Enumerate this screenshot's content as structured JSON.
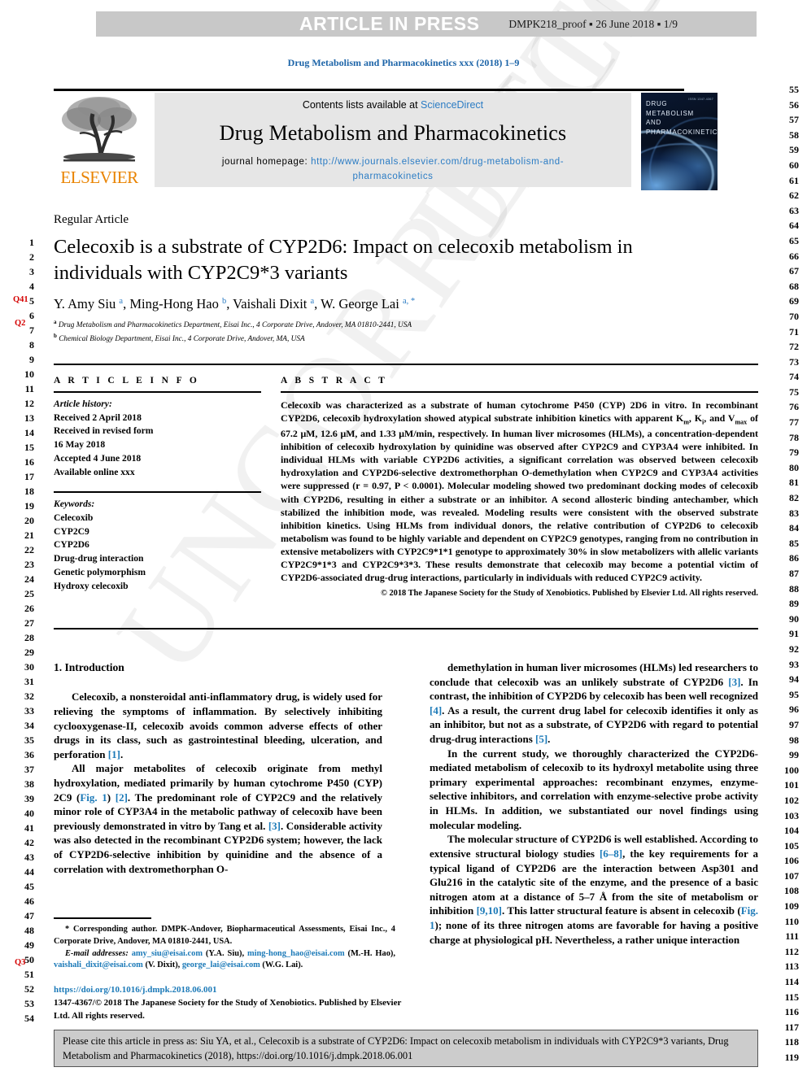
{
  "header": {
    "press_banner": "ARTICLE IN PRESS",
    "proof_meta": "DMPK218_proof ▪ 26 June 2018 ▪ 1/9",
    "running_head": "Drug Metabolism and Pharmacokinetics xxx (2018) 1–9"
  },
  "masthead": {
    "contents_prefix": "Contents lists available at ",
    "contents_link": "ScienceDirect",
    "journal_name": "Drug Metabolism and Pharmacokinetics",
    "homepage_label": "journal homepage: ",
    "homepage_url_line1": "http://www.journals.elsevier.com/drug-metabolism-and-",
    "homepage_url_line2": "pharmacokinetics",
    "publisher_logo_text": "ELSEVIER",
    "cover_title": "DRUG METABOLISM AND PHARMACOKINETICS",
    "cover_volume": "ISSN 1347-4367"
  },
  "article": {
    "type_label": "Regular Article",
    "title": "Celecoxib is a substrate of CYP2D6: Impact on celecoxib metabolism in individuals with CYP2C9*3 variants",
    "authors_plain": "Y. Amy Siu a, Ming-Hong Hao b, Vaishali Dixit a, W. George Lai a, *",
    "authors": [
      {
        "name": "Y. Amy Siu",
        "marks": "a"
      },
      {
        "name": "Ming-Hong Hao",
        "marks": "b"
      },
      {
        "name": "Vaishali Dixit",
        "marks": "a"
      },
      {
        "name": "W. George Lai",
        "marks": "a, *"
      }
    ],
    "affiliations": [
      {
        "mark": "a",
        "text": "Drug Metabolism and Pharmacokinetics Department, Eisai Inc., 4 Corporate Drive, Andover, MA 01810-2441, USA"
      },
      {
        "mark": "b",
        "text": "Chemical Biology Department, Eisai Inc., 4 Corporate Drive, Andover, MA, USA"
      }
    ]
  },
  "article_info": {
    "heading": "A R T I C L E   I N F O",
    "history_label": "Article history:",
    "history": [
      "Received 2 April 2018",
      "Received in revised form",
      "16 May 2018",
      "Accepted 4 June 2018",
      "Available online xxx"
    ],
    "keywords_label": "Keywords:",
    "keywords": [
      "Celecoxib",
      "CYP2C9",
      "CYP2D6",
      "Drug-drug interaction",
      "Genetic polymorphism",
      "Hydroxy celecoxib"
    ]
  },
  "abstract": {
    "heading": "A B S T R A C T",
    "text": "Celecoxib was characterized as a substrate of human cytochrome P450 (CYP) 2D6 in vitro. In recombinant CYP2D6, celecoxib hydroxylation showed atypical substrate inhibition kinetics with apparent Km, Ki, and Vmax of 67.2 μM, 12.6 μM, and 1.33 μM/min, respectively. In human liver microsomes (HLMs), a concentration-dependent inhibition of celecoxib hydroxylation by quinidine was observed after CYP2C9 and CYP3A4 were inhibited. In individual HLMs with variable CYP2D6 activities, a significant correlation was observed between celecoxib hydroxylation and CYP2D6-selective dextromethorphan O-demethylation when CYP2C9 and CYP3A4 activities were suppressed (r = 0.97, P < 0.0001). Molecular modeling showed two predominant docking modes of celecoxib with CYP2D6, resulting in either a substrate or an inhibitor. A second allosteric binding antechamber, which stabilized the inhibition mode, was revealed. Modeling results were consistent with the observed substrate inhibition kinetics. Using HLMs from individual donors, the relative contribution of CYP2D6 to celecoxib metabolism was found to be highly variable and dependent on CYP2C9 genotypes, ranging from no contribution in extensive metabolizers with CYP2C9*1*1 genotype to approximately 30% in slow metabolizers with allelic variants CYP2C9*1*3 and CYP2C9*3*3. These results demonstrate that celecoxib may become a potential victim of CYP2D6-associated drug-drug interactions, particularly in individuals with reduced CYP2C9 activity.",
    "copyright": "© 2018 The Japanese Society for the Study of Xenobiotics. Published by Elsevier Ltd. All rights reserved."
  },
  "introduction": {
    "heading": "1. Introduction",
    "left_paragraphs": [
      "Celecoxib, a nonsteroidal anti-inflammatory drug, is widely used for relieving the symptoms of inflammation. By selectively inhibiting cyclooxygenase-II, celecoxib avoids common adverse effects of other drugs in its class, such as gastrointestinal bleeding, ulceration, and perforation [1].",
      "All major metabolites of celecoxib originate from methyl hydroxylation, mediated primarily by human cytochrome P450 (CYP) 2C9 (Fig. 1) [2]. The predominant role of CYP2C9 and the relatively minor role of CYP3A4 in the metabolic pathway of celecoxib have been previously demonstrated in vitro by Tang et al. [3]. Considerable activity was also detected in the recombinant CYP2D6 system; however, the lack of CYP2D6-selective inhibition by quinidine and the absence of a correlation with dextromethorphan O-"
    ],
    "right_paragraphs": [
      "demethylation in human liver microsomes (HLMs) led researchers to conclude that celecoxib was an unlikely substrate of CYP2D6 [3]. In contrast, the inhibition of CYP2D6 by celecoxib has been well recognized [4]. As a result, the current drug label for celecoxib identifies it only as an inhibitor, but not as a substrate, of CYP2D6 with regard to potential drug-drug interactions [5].",
      "In the current study, we thoroughly characterized the CYP2D6-mediated metabolism of celecoxib to its hydroxyl metabolite using three primary experimental approaches: recombinant enzymes, enzyme-selective inhibitors, and correlation with enzyme-selective probe activity in HLMs. In addition, we substantiated our novel findings using molecular modeling.",
      "The molecular structure of CYP2D6 is well established. According to extensive structural biology studies [6–8], the key requirements for a typical ligand of CYP2D6 are the interaction between Asp301 and Glu216 in the catalytic site of the enzyme, and the presence of a basic nitrogen atom at a distance of 5–7 Å from the site of metabolism or inhibition [9,10]. This latter structural feature is absent in celecoxib (Fig. 1); none of its three nitrogen atoms are favorable for having a positive charge at physiological pH. Nevertheless, a rather unique interaction"
    ]
  },
  "footnotes": {
    "corresponding": "* Corresponding author. DMPK-Andover, Biopharmaceutical Assessments, Eisai Inc., 4 Corporate Drive, Andover, MA 01810-2441, USA.",
    "email_label": "E-mail addresses:",
    "emails": [
      {
        "address": "amy_siu@eisai.com",
        "who": "(Y.A. Siu)"
      },
      {
        "address": "ming-hong_hao@eisai.com",
        "who": "(M.-H. Hao)"
      },
      {
        "address": "vaishali_dixit@eisai.com",
        "who": "(V. Dixit)"
      },
      {
        "address": "george_lai@eisai.com",
        "who": "(W.G. Lai)"
      }
    ],
    "doi": "https://doi.org/10.1016/j.dmpk.2018.06.001",
    "issn_copyright": "1347-4367/© 2018 The Japanese Society for the Study of Xenobiotics. Published by Elsevier Ltd. All rights reserved."
  },
  "citation_box": {
    "text": "Please cite this article in press as: Siu YA, et al., Celecoxib is a substrate of CYP2D6: Impact on celecoxib metabolism in individuals with CYP2C9*3 variants, Drug Metabolism and Pharmacokinetics (2018), https://doi.org/10.1016/j.dmpk.2018.06.001"
  },
  "query_tags": [
    {
      "id": "Q41",
      "label": "Q41"
    },
    {
      "id": "Q2",
      "label": "Q2"
    },
    {
      "id": "Q3",
      "label": "Q3"
    }
  ],
  "line_numbers": {
    "left_start": 1,
    "left_end": 54,
    "right_start": 55,
    "right_end": 119
  },
  "watermark": {
    "text": "UNCORRECTED PROOF"
  },
  "colors": {
    "link": "#1c7ab8",
    "elsevier_orange": "#e98300",
    "band_gray": "#c8c8c8",
    "box_gray": "#e6e6e6",
    "query_red": "#d40000"
  }
}
